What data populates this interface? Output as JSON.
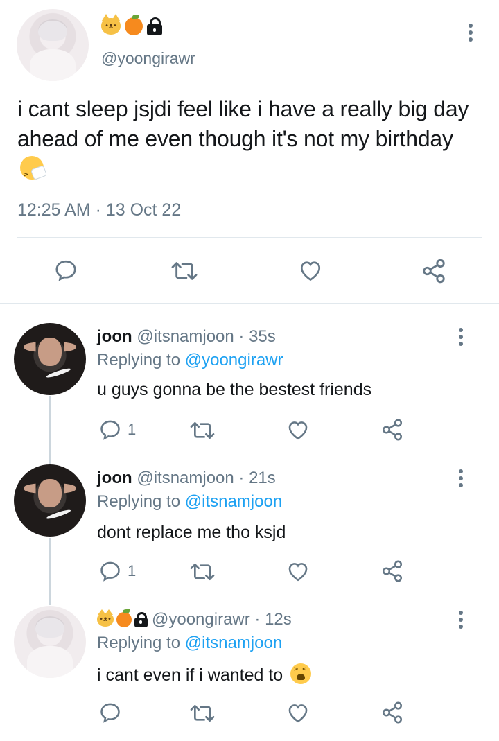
{
  "main_tweet": {
    "handle": "@yoongirawr",
    "text": "i cant sleep jsjdi feel like i have a really big day ahead of me even though it's not my birthday",
    "timestamp": "12:25 AM · 13 Oct 22",
    "name_emojis": [
      "cat-emoji",
      "tangerine-emoji",
      "lock-emoji"
    ],
    "trailing_emoji": "sneezing-face-emoji"
  },
  "replies": [
    {
      "name": "joon",
      "meta": "@itsnamjoon · 35s",
      "replying_prefix": "Replying to",
      "replying_to": "@yoongirawr",
      "text": "u guys gonna be the bestest friends",
      "reply_count": "1"
    },
    {
      "name": "joon",
      "meta": "@itsnamjoon · 21s",
      "replying_prefix": "Replying to",
      "replying_to": "@itsnamjoon",
      "text": "dont replace me tho ksjd",
      "reply_count": "1"
    },
    {
      "name": "",
      "meta": "@yoongirawr · 12s",
      "replying_prefix": "Replying to",
      "replying_to": "@itsnamjoon",
      "text": "i cant even if i wanted to",
      "reply_count": "",
      "trailing_emoji": "weary-face-emoji"
    }
  ],
  "colors": {
    "text": "#14171a",
    "muted": "#657786",
    "link": "#1da1f2",
    "divider": "#e1e8ed"
  }
}
